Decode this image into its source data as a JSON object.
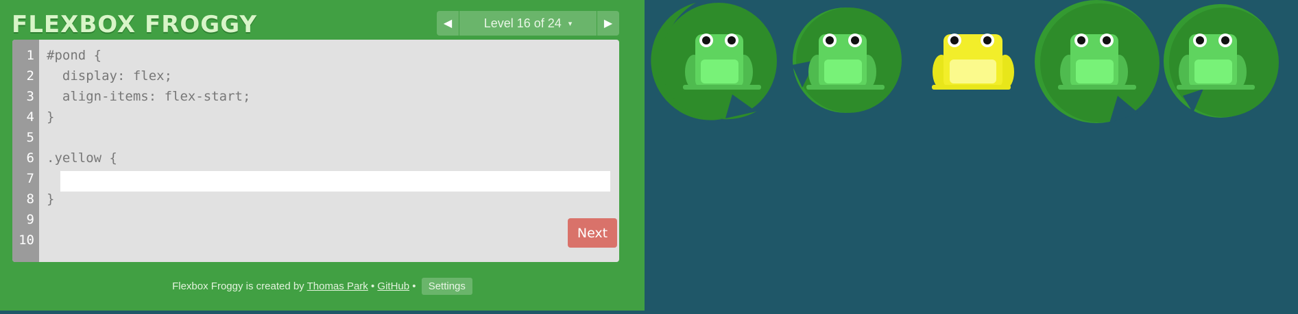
{
  "app": {
    "title": "FLEXBOX FROGGY"
  },
  "level_nav": {
    "prev_icon": "triangle-left-icon",
    "label": "Level 16 of 24",
    "caret": "▾",
    "next_icon": "triangle-right-icon"
  },
  "editor": {
    "line_numbers": [
      "1",
      "2",
      "3",
      "4",
      "5",
      "6",
      "7",
      "8",
      "9",
      "10"
    ],
    "code_lines": [
      "#pond {",
      "  display: flex;",
      "  align-items: flex-start;",
      "}",
      "",
      ".yellow {",
      "",
      "}"
    ],
    "input_value": "",
    "next_label": "Next"
  },
  "footer": {
    "text_before": "Flexbox Froggy is created by",
    "author_link": "Thomas Park",
    "separator": "•",
    "github_link": "GitHub",
    "settings_label": "Settings"
  },
  "pond": {
    "lilypads": [
      "green",
      "green",
      "yellow",
      "green",
      "green"
    ],
    "frogs": [
      "green",
      "green",
      "yellow",
      "green",
      "green"
    ]
  },
  "colors": {
    "sidebar_bg": "#41a043",
    "pond_bg": "#1f5768",
    "next_button": "#d9726a",
    "lilypad_green": "#2e8c2a",
    "frog_green": "#5fd45f",
    "frog_yellow": "#f2ee2a"
  }
}
